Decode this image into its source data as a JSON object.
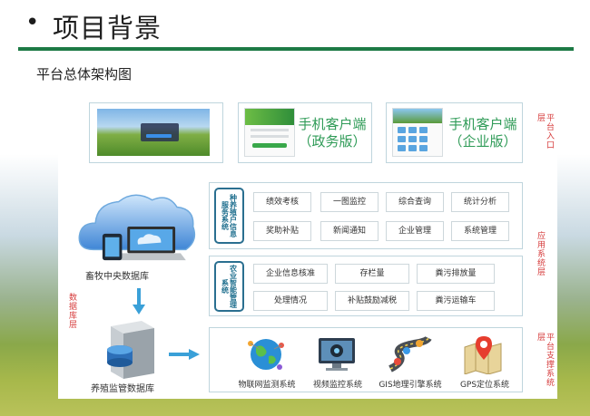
{
  "slide": {
    "bullet": "•",
    "title": "项目背景",
    "subtitle": "平台总体架构图"
  },
  "layers": {
    "entry": "平台入口层",
    "application": "应用系统层",
    "support": "平台支撑系统层",
    "data": "数据库层"
  },
  "entry": {
    "clients": [
      {
        "line1": "手机客户端",
        "line2": "（政务版）"
      },
      {
        "line1": "手机客户端",
        "line2": "（企业版）"
      }
    ]
  },
  "databases": {
    "central": "畜牧中央数据库",
    "monitor": "养殖监管数据库"
  },
  "application": {
    "system1": {
      "name": "种养殖户信息服务系统",
      "functions": [
        "绩效考核",
        "一图监控",
        "综合查询",
        "统计分析",
        "奖助补贴",
        "新闻通知",
        "企业管理",
        "系统管理"
      ]
    },
    "system2": {
      "name": "农业智能管理系统",
      "functions": [
        "企业信息核准",
        "存栏量",
        "粪污排放量",
        "处理情况",
        "补贴鼓励减税",
        "粪污运输车"
      ]
    }
  },
  "support": {
    "items": [
      {
        "label": "物联网监测系统",
        "icon": "iot-globe-icon"
      },
      {
        "label": "视频监控系统",
        "icon": "video-monitor-icon"
      },
      {
        "label": "GIS地理引擎系统",
        "icon": "gis-road-icon"
      },
      {
        "label": "GPS定位系统",
        "icon": "gps-map-icon"
      }
    ]
  },
  "colors": {
    "accent_green": "#1d7a45",
    "client_text": "#2f9b57",
    "layer_text": "#d63b3b",
    "system_tag": "#1f6f8e"
  }
}
